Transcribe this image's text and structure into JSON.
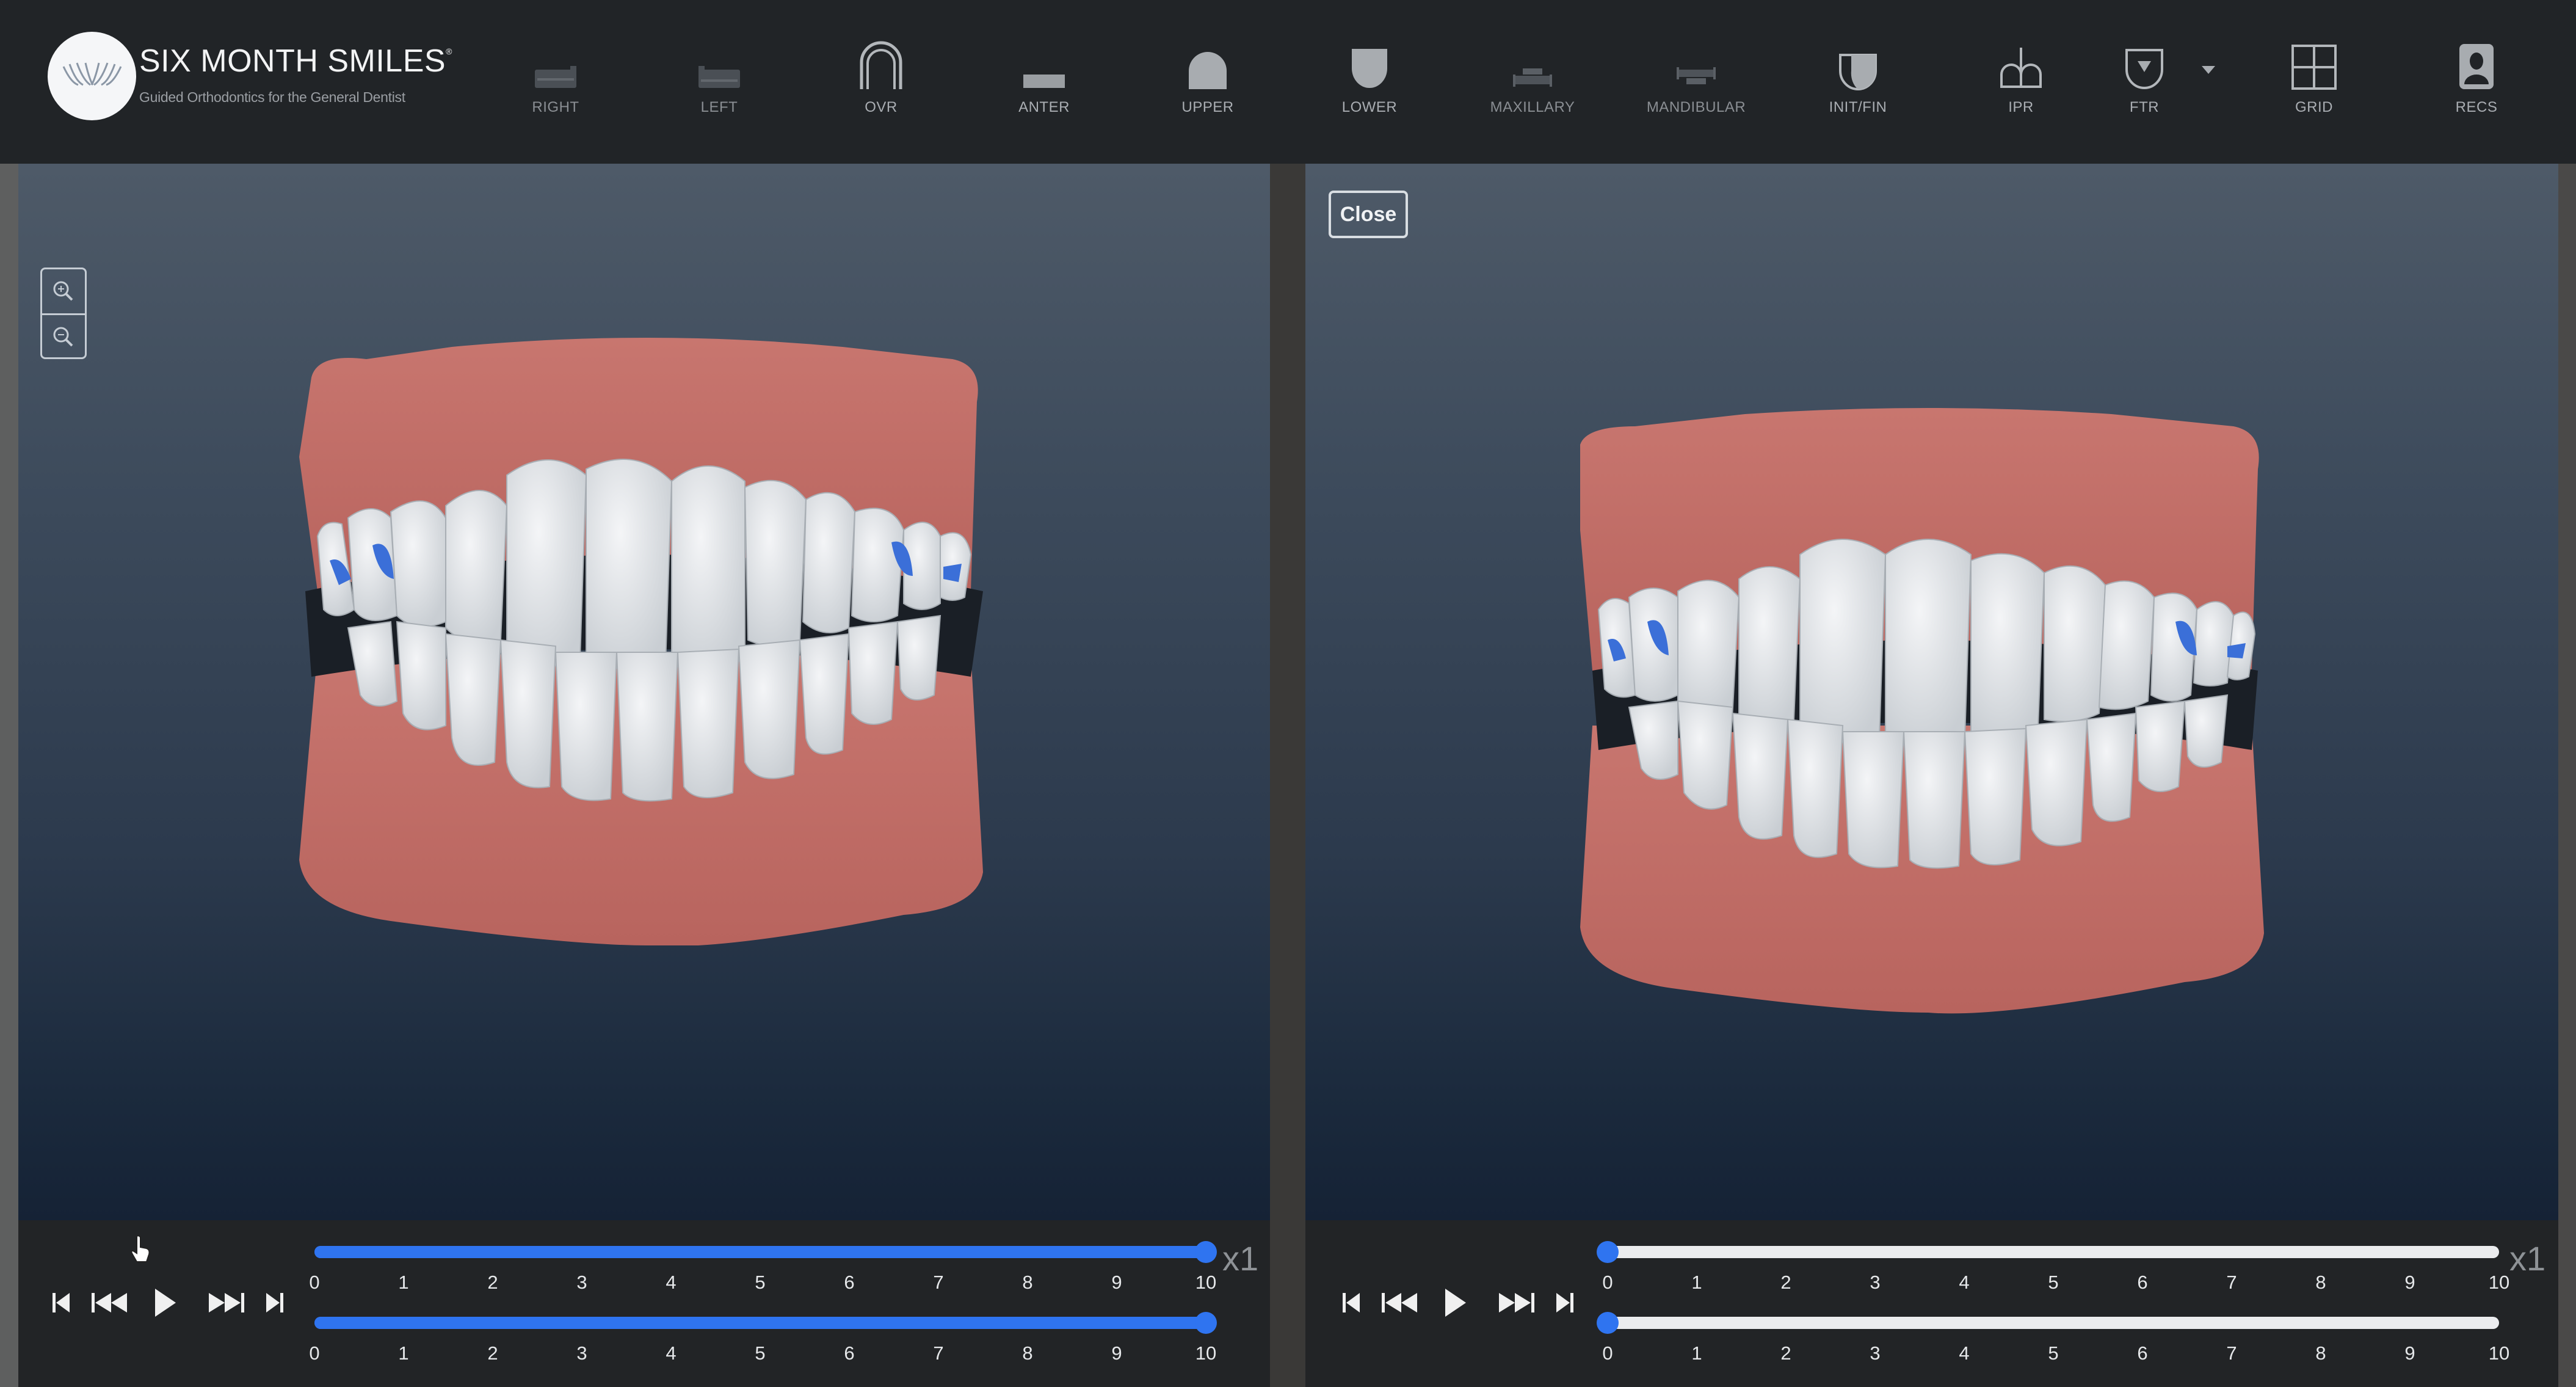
{
  "header": {
    "brand": "SIX MONTH SMILES",
    "registered_mark": "®",
    "tagline": "Guided Orthodontics for the General Dentist",
    "tools": [
      {
        "id": "right",
        "label": "RIGHT",
        "icon": "right-view-icon",
        "dim": true
      },
      {
        "id": "left",
        "label": "LEFT",
        "icon": "left-view-icon",
        "dim": true
      },
      {
        "id": "ovr",
        "label": "OVR",
        "icon": "overlay-arch-icon",
        "dim": false
      },
      {
        "id": "anter",
        "label": "ANTER",
        "icon": "anterior-view-icon",
        "dim": false
      },
      {
        "id": "upper",
        "label": "UPPER",
        "icon": "upper-arch-icon",
        "dim": false
      },
      {
        "id": "lower",
        "label": "LOWER",
        "icon": "lower-arch-icon",
        "dim": false
      },
      {
        "id": "maxillary",
        "label": "MAXILLARY",
        "icon": "maxillary-icon",
        "dim": true
      },
      {
        "id": "mandibular",
        "label": "MANDIBULAR",
        "icon": "mandibular-icon",
        "dim": true
      },
      {
        "id": "initfin",
        "label": "INIT/FIN",
        "icon": "init-fin-icon",
        "dim": false
      },
      {
        "id": "ipr",
        "label": "IPR",
        "icon": "ipr-icon",
        "dim": false
      },
      {
        "id": "ftr",
        "label": "FTR",
        "icon": "ftr-shield-icon",
        "dim": false,
        "has_dropdown": true
      },
      {
        "id": "grid",
        "label": "GRID",
        "icon": "grid-icon",
        "dim": false
      },
      {
        "id": "recs",
        "label": "RECS",
        "icon": "records-person-icon",
        "dim": false
      }
    ]
  },
  "colors": {
    "accent_blue": "#2f74f0",
    "gum": "#c9746c",
    "tooth": "#e4e7ea",
    "toolbar_bg": "#212427",
    "controls_bg": "#222426"
  },
  "viewer_left": {
    "zoom_in_label": "zoom in",
    "zoom_out_label": "zoom out",
    "model_description": "3D dental model - initial position with attachments",
    "playback": {
      "upper_slider": {
        "min": 0,
        "max": 10,
        "value": 10
      },
      "lower_slider": {
        "min": 0,
        "max": 10,
        "value": 10
      },
      "speed": "x1",
      "ticks": [
        "0",
        "1",
        "2",
        "3",
        "4",
        "5",
        "6",
        "7",
        "8",
        "9",
        "10"
      ]
    }
  },
  "viewer_right": {
    "close_label": "Close",
    "model_description": "3D dental model - final position with attachments",
    "playback": {
      "upper_slider": {
        "min": 0,
        "max": 10,
        "value": 0
      },
      "lower_slider": {
        "min": 0,
        "max": 10,
        "value": 0
      },
      "speed": "x1",
      "ticks": [
        "0",
        "1",
        "2",
        "3",
        "4",
        "5",
        "6",
        "7",
        "8",
        "9",
        "10"
      ]
    }
  }
}
